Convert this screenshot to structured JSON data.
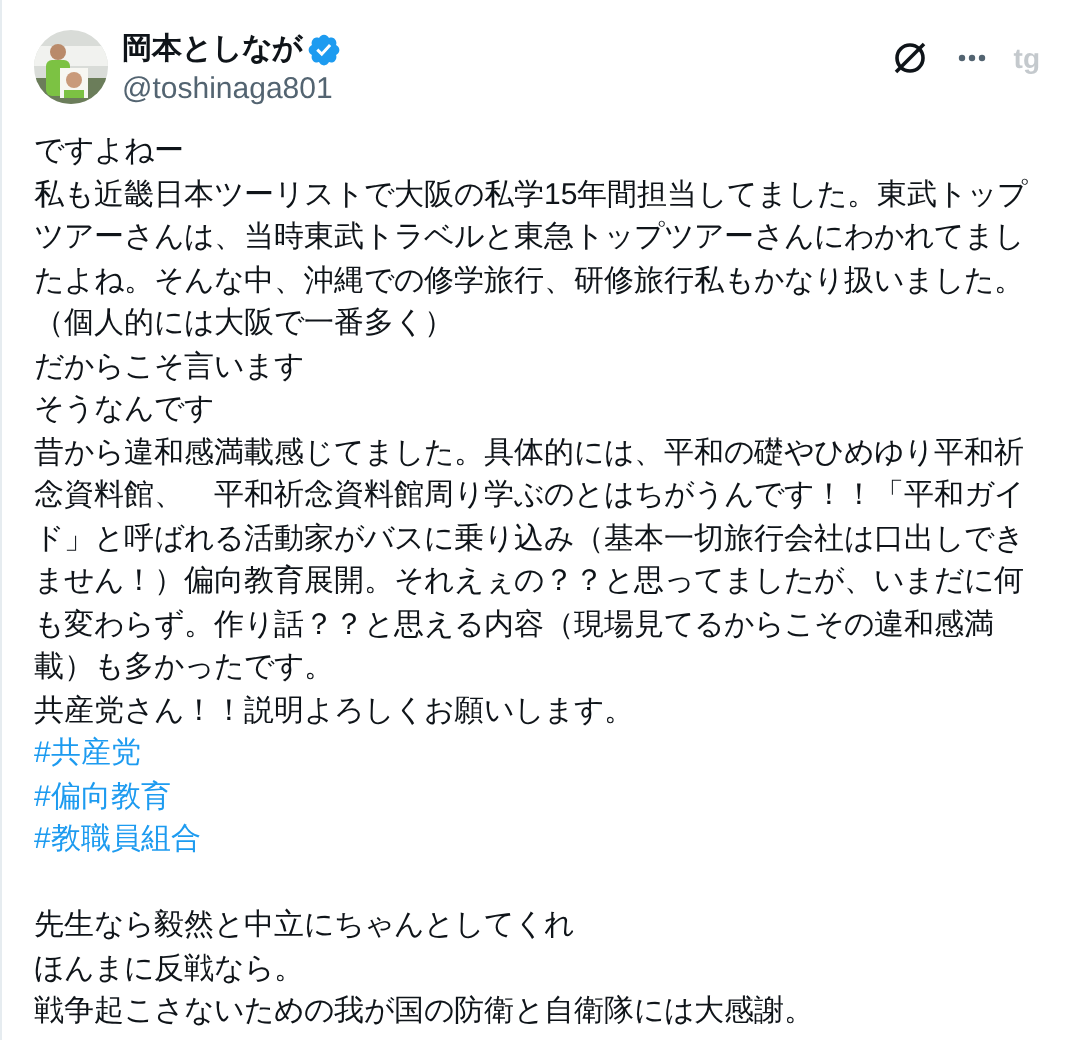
{
  "author": {
    "name": "岡本としなが",
    "verified": true,
    "handle": "@toshinaga801"
  },
  "header_actions": {
    "extension_label": "tg"
  },
  "body": [
    {
      "kind": "text",
      "text": "ですよねー"
    },
    {
      "kind": "text",
      "text": "私も近畿日本ツーリストで大阪の私学15年間担当してました。東武トップツアーさんは、当時東武トラベルと東急トップツアーさんにわかれてましたよね。そんな中、沖縄での修学旅行、研修旅行私もかなり扱いました。（個人的には大阪で一番多く）"
    },
    {
      "kind": "text",
      "text": "だからこそ言います"
    },
    {
      "kind": "text",
      "text": "そうなんです"
    },
    {
      "kind": "text",
      "text": "昔から違和感満載感じてました。具体的には、平和の礎やひめゆり平和祈念資料館、　平和祈念資料館周り学ぶのとはちがうんです！！「平和ガイド」と呼ばれる活動家がバスに乗り込み（基本一切旅行会社は口出しできません！）偏向教育展開。それえぇの？？と思ってましたが、いまだに何も変わらず。作り話？？と思える内容（現場見てるからこその違和感満載）も多かったです。"
    },
    {
      "kind": "text",
      "text": "共産党さん！！説明よろしくお願いします。"
    },
    {
      "kind": "hashtag",
      "text": "#共産党"
    },
    {
      "kind": "hashtag",
      "text": "#偏向教育"
    },
    {
      "kind": "hashtag",
      "text": "#教職員組合"
    },
    {
      "kind": "blank"
    },
    {
      "kind": "text",
      "text": "先生なら毅然と中立にちゃんとしてくれ"
    },
    {
      "kind": "text",
      "text": "ほんまに反戦なら。"
    },
    {
      "kind": "text",
      "text": "戦争起こさないための我が国の防衛と自衛隊には大感謝。"
    }
  ]
}
